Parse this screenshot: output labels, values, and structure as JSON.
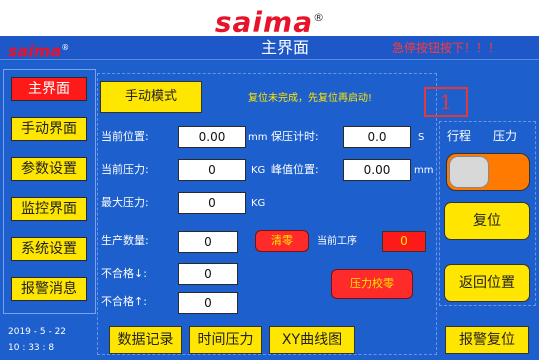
{
  "brand": {
    "logo_text": "saima",
    "reg_mark": "®"
  },
  "header": {
    "logo_text": "saima",
    "reg_mark": "®",
    "title": "主界面",
    "alarm": "急停按钮按下！！！"
  },
  "nav": {
    "items": [
      {
        "label": "主界面",
        "active": true
      },
      {
        "label": "手动界面",
        "active": false
      },
      {
        "label": "参数设置",
        "active": false
      },
      {
        "label": "监控界面",
        "active": false
      },
      {
        "label": "系统设置",
        "active": false
      },
      {
        "label": "报警消息",
        "active": false
      }
    ]
  },
  "main": {
    "manual_button": "手动模式",
    "status_message": "复位未完成，先复位再启动!",
    "marker": "1",
    "current_position": {
      "label": "当前位置:",
      "value": "0.00",
      "unit": "mm"
    },
    "hold_timer": {
      "label": "保压计时:",
      "value": "0.0",
      "unit": "S"
    },
    "current_pressure": {
      "label": "当前压力:",
      "value": "0",
      "unit": "KG"
    },
    "peak_position": {
      "label": "峰值位置:",
      "value": "0.00",
      "unit": "mm"
    },
    "max_pressure": {
      "label": "最大压力:",
      "value": "0",
      "unit": "KG"
    },
    "production_qty": {
      "label": "生产数量:",
      "value": "0"
    },
    "clear_button": "清零",
    "current_step": {
      "label": "当前工序",
      "value": "0"
    },
    "ng_down": {
      "label": "不合格↓:",
      "value": "0"
    },
    "ng_up": {
      "label": "不合格↑:",
      "value": "0"
    },
    "pressure_calibration": "压力校零"
  },
  "right": {
    "stroke_label": "行程",
    "pressure_label": "压力",
    "reset_button": "复位",
    "return_button": "返回位置"
  },
  "footer": {
    "date": "2019 - 5 - 22",
    "time": "10 : 33 : 8",
    "data_record": "数据记录",
    "time_pressure": "时间压力",
    "xy_curve": "XY曲线图",
    "alarm_reset": "报警复位"
  },
  "colors": {
    "panel_blue": "#1d5fcc",
    "button_yellow": "#ffe600",
    "alarm_red": "#ff1a1a",
    "toggle_orange": "#ff7a00"
  }
}
